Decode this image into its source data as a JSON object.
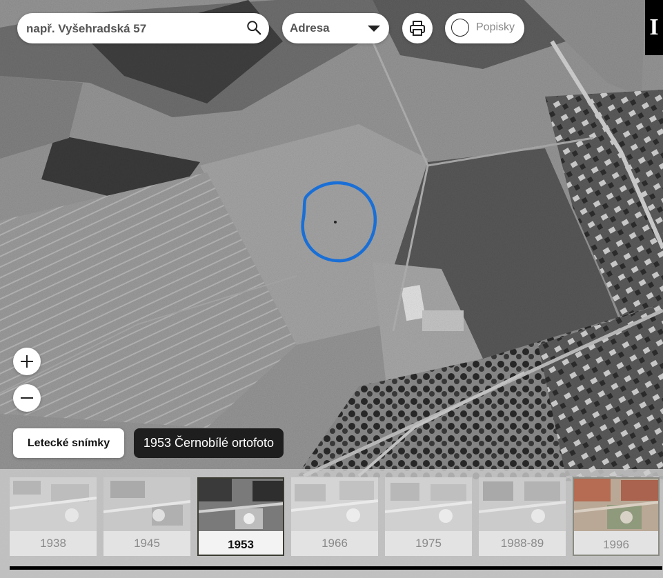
{
  "search": {
    "placeholder": "např. Vyšehradská 57",
    "value": ""
  },
  "search_type": {
    "selected": "Adresa"
  },
  "labels_toggle": {
    "label": "Popisky",
    "checked": false
  },
  "info_button": {
    "label": "I"
  },
  "layers": {
    "aerial_label": "Letecké snímky",
    "current_layer": "1953 Černobílé ortofoto"
  },
  "timeline": {
    "years": [
      "1938",
      "1945",
      "1953",
      "1966",
      "1975",
      "1988-89",
      "1996"
    ],
    "active_index": 2
  },
  "colors": {
    "marker": "#1a6fd6",
    "badge": "#1e1e1e",
    "panel": "#cdcdcd"
  },
  "icons": [
    "search-icon",
    "print-icon",
    "zoom-in-icon",
    "zoom-out-icon",
    "chevron-down-icon",
    "circle-toggle-icon"
  ]
}
